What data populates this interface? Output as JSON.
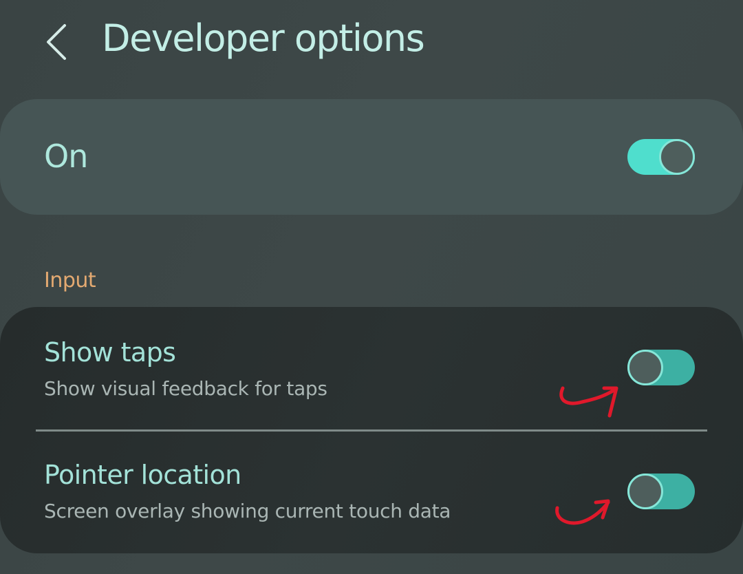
{
  "header": {
    "title": "Developer options",
    "back_icon": "chevron-left-icon"
  },
  "master": {
    "label": "On",
    "enabled": true
  },
  "sections": [
    {
      "label": "Input",
      "items": [
        {
          "title": "Show taps",
          "subtitle": "Show visual feedback for taps",
          "enabled": false
        },
        {
          "title": "Pointer location",
          "subtitle": "Screen overlay showing current touch data",
          "enabled": false
        }
      ]
    }
  ],
  "annotations": [
    {
      "icon": "red-curved-arrow-icon",
      "points_to": "Show taps toggle"
    },
    {
      "icon": "red-curved-arrow-icon",
      "points_to": "Pointer location toggle"
    }
  ],
  "colors": {
    "background": "#3d4747",
    "title": "#c3eee6",
    "accent": "#4fdecd",
    "section_label": "#e3a971",
    "annotation": "#e0192b"
  }
}
